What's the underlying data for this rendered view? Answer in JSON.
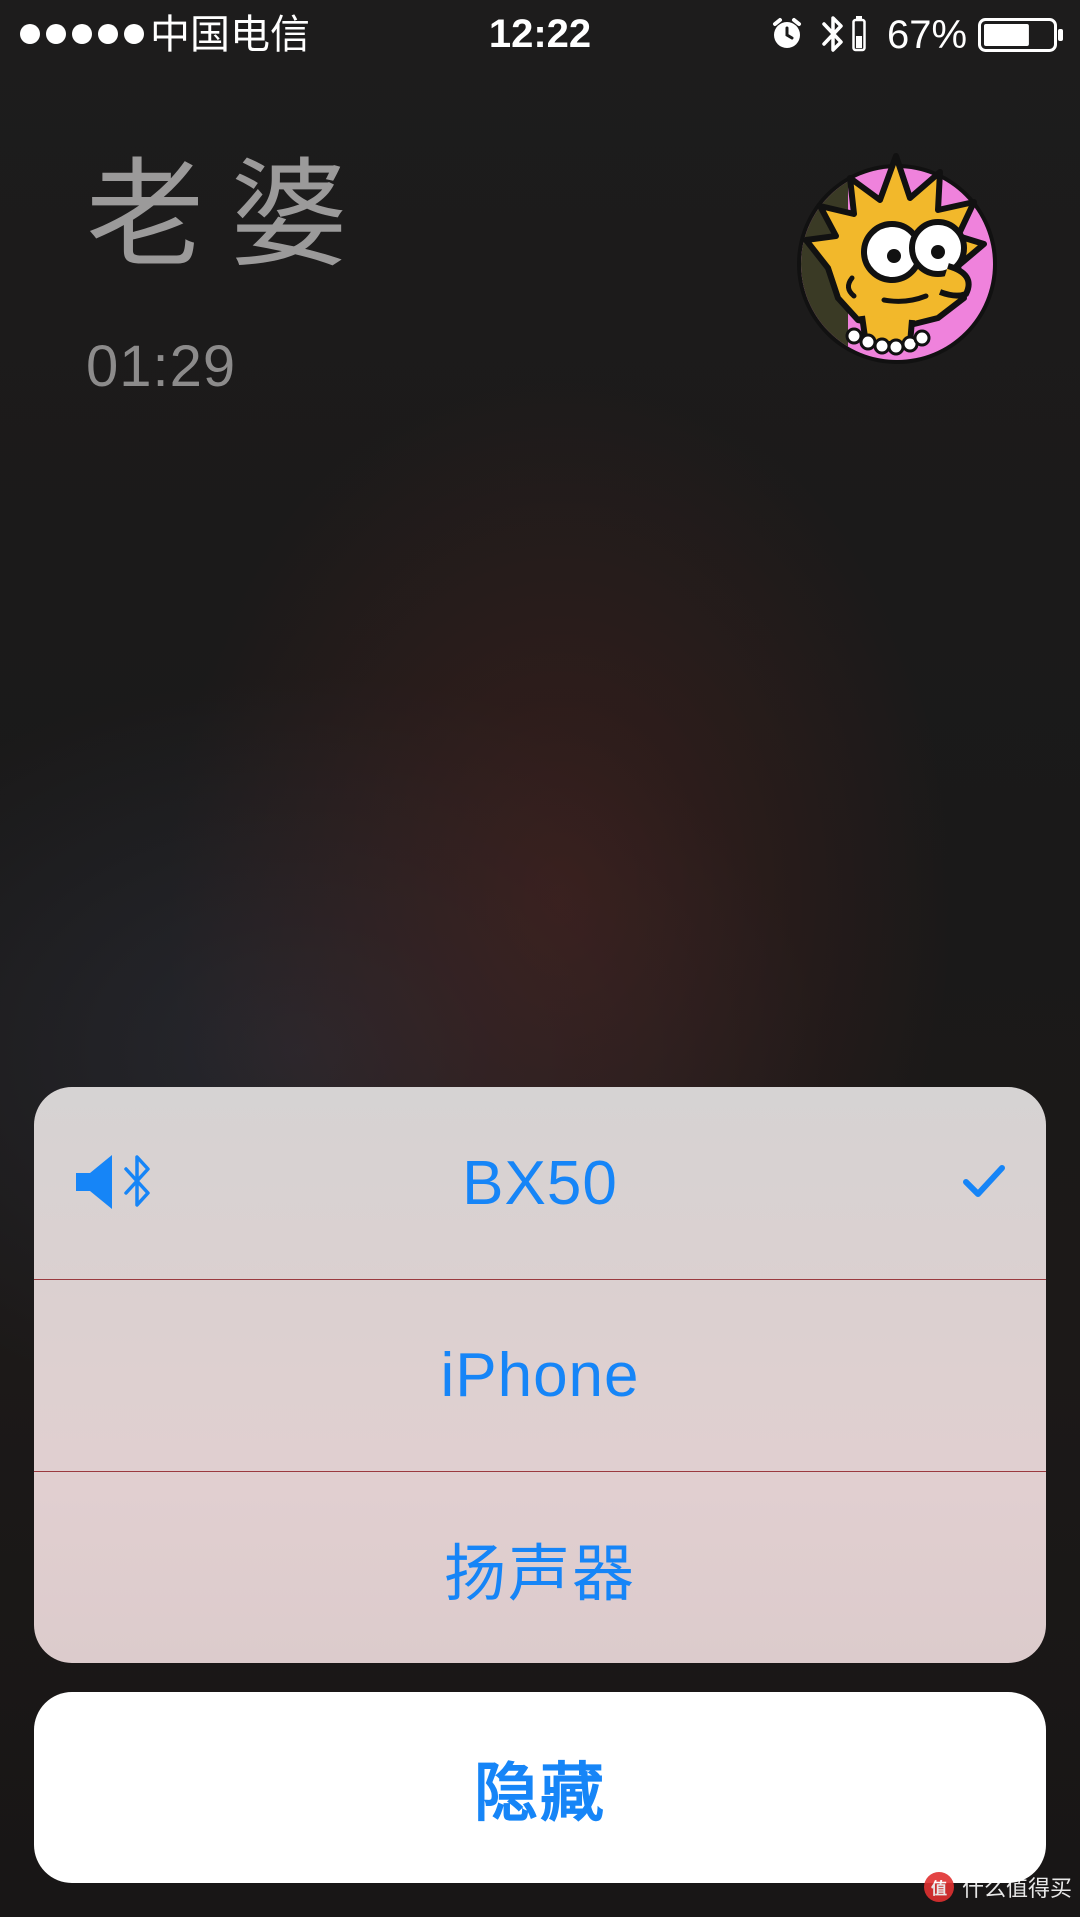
{
  "status_bar": {
    "signal_dots": 5,
    "carrier": "中国电信",
    "time": "12:22",
    "alarm_icon": "alarm-clock-icon",
    "bluetooth_icon": "bluetooth-icon",
    "battery_percent": "67%",
    "battery_level": 0.67
  },
  "call": {
    "caller_name": "老婆",
    "duration": "01:29",
    "avatar_icon": "cartoon-avatar-icon"
  },
  "audio_routes": {
    "options": [
      {
        "label": "BX50",
        "selected": true,
        "icons": [
          "speaker-icon",
          "bluetooth-icon"
        ],
        "check_icon": "checkmark-icon"
      },
      {
        "label": "iPhone",
        "selected": false
      },
      {
        "label": "扬声器",
        "selected": false
      }
    ],
    "hide_label": "隐藏"
  },
  "watermark": {
    "text": "什么值得买",
    "logo_text": "值"
  },
  "colors": {
    "accent": "#1685f7",
    "divider": "#9a3a3f",
    "sheet_background": "#dcd0d0",
    "caller_text": "#9b9a9a"
  }
}
